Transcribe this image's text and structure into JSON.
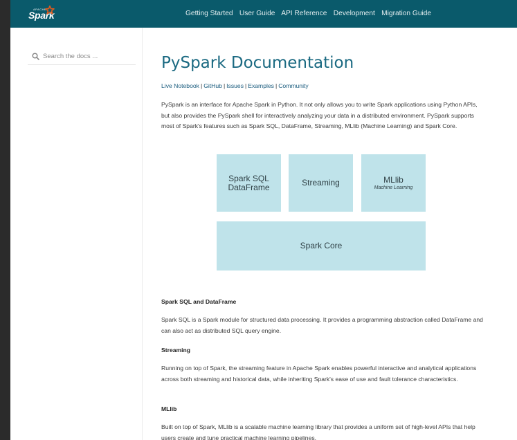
{
  "nav": {
    "logo_small": "APACHE",
    "logo_text": "Spark",
    "links": [
      "Getting Started",
      "User Guide",
      "API Reference",
      "Development",
      "Migration Guide"
    ]
  },
  "sidebar": {
    "search_placeholder": "Search the docs ..."
  },
  "main": {
    "title": "PySpark Documentation",
    "links": [
      "Live Notebook",
      "GitHub",
      "Issues",
      "Examples",
      "Community"
    ],
    "intro": "PySpark is an interface for Apache Spark in Python. It not only allows you to write Spark applications using Python APIs, but also provides the PySpark shell for interactively analyzing your data in a distributed environment. PySpark supports most of Spark's features such as Spark SQL, DataFrame, Streaming, MLlib (Machine Learning) and Spark Core.",
    "diagram": {
      "box1_line1": "Spark SQL",
      "box1_line2": "DataFrame",
      "box2": "Streaming",
      "box3": "MLlib",
      "box3_sub": "Machine Learning",
      "box4": "Spark Core",
      "color": "#bfe3ea"
    },
    "sections": [
      {
        "heading": "Spark SQL and DataFrame",
        "text": "Spark SQL is a Spark module for structured data processing. It provides a programming abstraction called DataFrame and can also act as distributed SQL query engine."
      },
      {
        "heading": "Streaming",
        "text": "Running on top of Spark, the streaming feature in Apache Spark enables powerful interactive and analytical applications across both streaming and historical data, while inheriting Spark's ease of use and fault tolerance characteristics."
      },
      {
        "heading": "MLlib",
        "text": "Built on top of Spark, MLlib is a scalable machine learning library that provides a uniform set of high-level APIs that help users create and tune practical machine learning pipelines."
      }
    ]
  },
  "colors": {
    "navbar": "#0a5a6b",
    "title": "#1b6a82",
    "link": "#1a5c7e",
    "accent_star": "#e25a1c"
  }
}
